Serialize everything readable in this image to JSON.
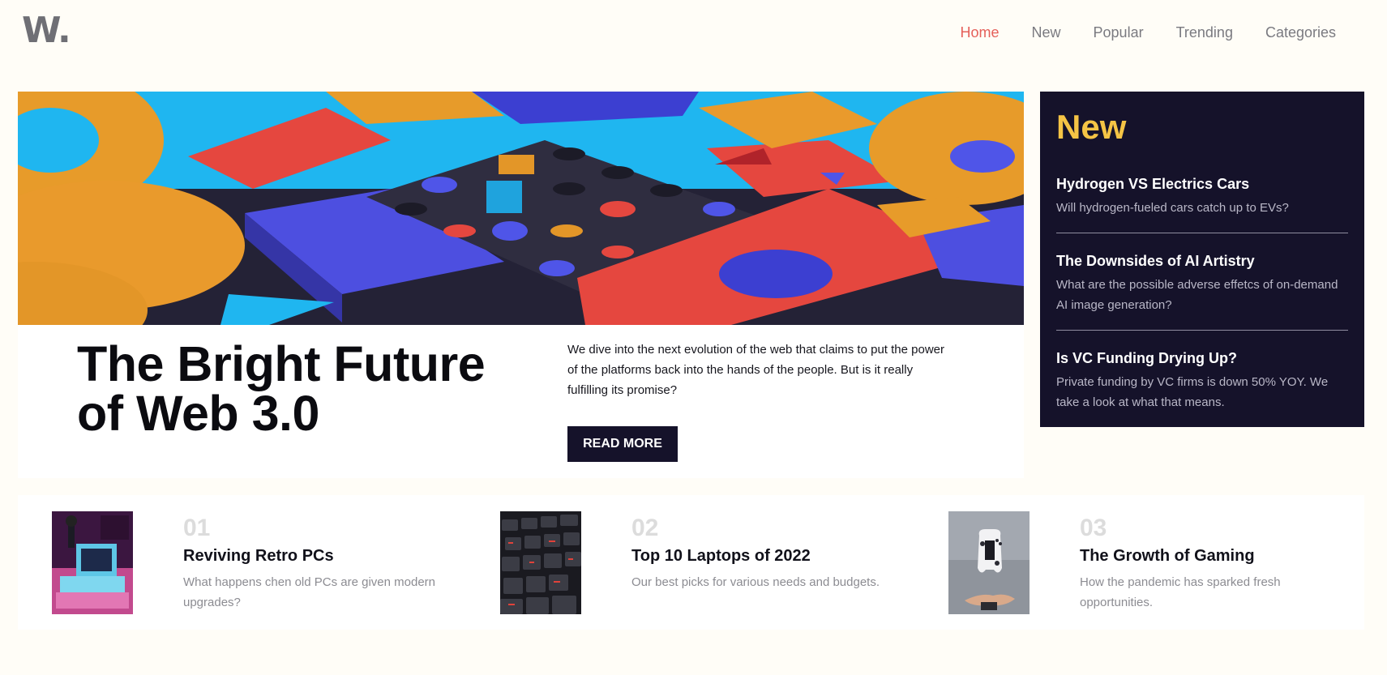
{
  "header": {
    "logo": "W.",
    "nav": [
      {
        "label": "Home",
        "active": true
      },
      {
        "label": "New",
        "active": false
      },
      {
        "label": "Popular",
        "active": false
      },
      {
        "label": "Trending",
        "active": false
      },
      {
        "label": "Categories",
        "active": false
      }
    ]
  },
  "hero": {
    "title": "The Bright Future of Web 3.0",
    "description": "We dive into the next evolution of the web that claims to put the power of the platforms back into the hands of the people. But is it really fulfilling its promise?",
    "button_label": "READ MORE"
  },
  "sidebar": {
    "title": "New",
    "items": [
      {
        "title": "Hydrogen VS Electrics Cars",
        "desc": "Will hydrogen-fueled cars catch up to EVs?"
      },
      {
        "title": "The Downsides of AI Artistry",
        "desc": "What are the possible adverse effetcs of on-demand AI image generation?"
      },
      {
        "title": "Is VC Funding Drying Up?",
        "desc": "Private funding by VC firms is down 50% YOY. We take a look at what that means."
      }
    ]
  },
  "cards": [
    {
      "num": "01",
      "title": "Reviving Retro PCs",
      "desc": "What happens chen old PCs are given modern upgrades?"
    },
    {
      "num": "02",
      "title": "Top 10 Laptops of 2022",
      "desc": "Our best picks for various needs and budgets."
    },
    {
      "num": "03",
      "title": "The Growth of Gaming",
      "desc": "How the pandemic has sparked fresh opportunities."
    }
  ],
  "colors": {
    "accent": "#e5605a",
    "dark": "#15122a",
    "highlight": "#f5c445"
  }
}
